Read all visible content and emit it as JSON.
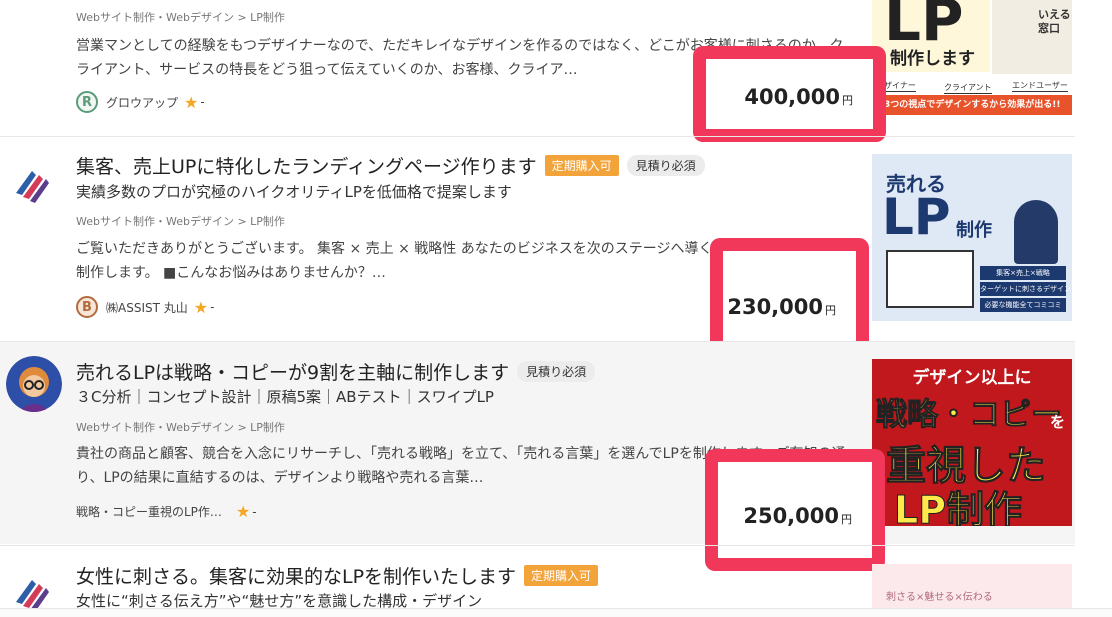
{
  "listings": [
    {
      "title": "",
      "category": "Webサイト制作・Webデザイン > LP制作",
      "description": "営業マンとしての経験をもつデザイナーなので、ただキレイなデザインを作るのではなく、どこがお客様に刺さるのか、クライアント、サービスの特長をどう狙って伝えていくのか、お客様、クライア…",
      "seller": "グロウアップ",
      "seller_rank": "R",
      "rating": "-",
      "price": "400,000",
      "currency": "円",
      "thumb_text": [
        "LP",
        "制作します",
        "デザイナー",
        "クライアント",
        "エンドユーザー",
        "3つの視点でデザインするから効果が出る!!",
        "いえる",
        "窓口"
      ]
    },
    {
      "title": "集客、売上UPに特化したランディングページ作ります",
      "badges": [
        "定期購入可",
        "見積り必須"
      ],
      "subtitle": "実績多数のプロが究極のハイクオリティLPを低価格で提案します",
      "category": "Webサイト制作・Webデザイン > LP制作",
      "description": "ご覧いただきありがとうございます。 集客 × 売上 × 戦略性 あなたのビジネスを次のステージへ導くハイクオリティLPを制作します。 ■こんなお悩みはありませんか？…",
      "seller": "㈱ASSIST 丸山",
      "seller_rank": "B",
      "rating": "-",
      "price": "230,000",
      "currency": "円",
      "thumb_text": [
        "売れる",
        "LP",
        "制作",
        "集客×売上×戦略",
        "ターゲットに刺さるデザイン",
        "必要な機能全てコミコミ"
      ]
    },
    {
      "title": "売れるLPは戦略・コピーが9割を主軸に制作します",
      "badges": [
        "見積り必須"
      ],
      "subtitle": "３C分析｜コンセプト設計｜原稿5案｜ABテスト｜スワイプLP",
      "category": "Webサイト制作・Webデザイン > LP制作",
      "description": "貴社の商品と顧客、競合を入念にリサーチし、「売れる戦略」を立て、「売れる言葉」を選んでLPを制作します。ご存知の通り、LPの結果に直結するのは、デザインより戦略や売れる言葉…",
      "seller": "戦略・コピー重視のLP作…",
      "rating": "-",
      "price": "250,000",
      "currency": "円",
      "thumb_text": [
        "デザイン以上に",
        "戦略・コピー",
        "を",
        "重視した",
        "LP制作"
      ]
    },
    {
      "title": "女性に刺さる。集客に効果的なLPを制作いたします",
      "badges": [
        "定期購入可"
      ],
      "subtitle": "女性に“刺さる伝え方”や“魅せ方”を意識した構成・デザイン",
      "thumb_text": [
        "刺さる×魅せる×伝わる"
      ]
    }
  ],
  "colors": {
    "highlight": "#f2385a",
    "badge_orange": "#f2a33a",
    "star": "#f5a623"
  }
}
